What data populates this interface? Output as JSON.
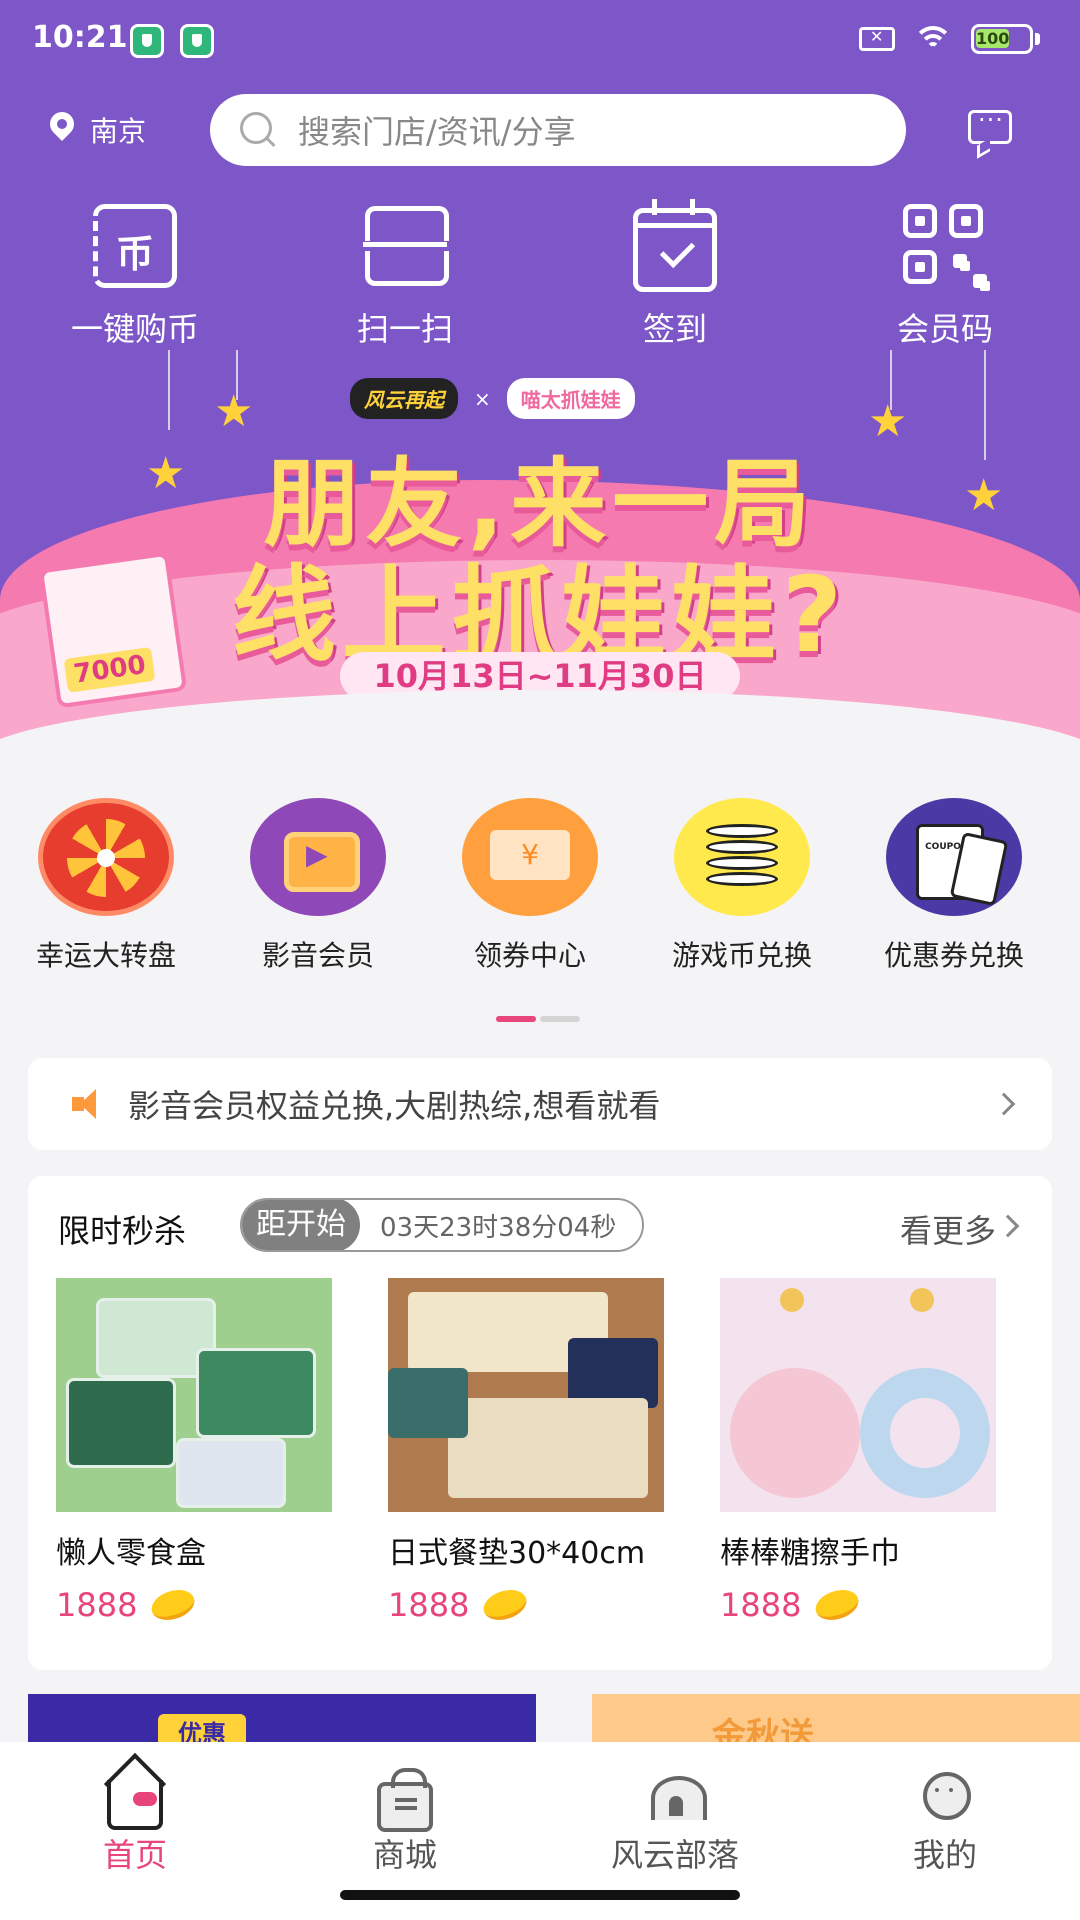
{
  "status_bar": {
    "time": "10:21",
    "battery": "100"
  },
  "header": {
    "city": "南京",
    "search_placeholder": "搜索门店/资讯/分享",
    "quick_actions": [
      {
        "label": "一键购币",
        "icon": "coin-icon",
        "glyph": "币"
      },
      {
        "label": "扫一扫",
        "icon": "scan-icon"
      },
      {
        "label": "签到",
        "icon": "calendar-check-icon"
      },
      {
        "label": "会员码",
        "icon": "qr-code-icon"
      }
    ]
  },
  "banner": {
    "brand_left": "风云再起",
    "separator": "×",
    "brand_right": "喵太抓娃娃",
    "headline_1": "朋友,来一局",
    "headline_2": "线上抓娃娃?",
    "dates": "10月13日~11月30日",
    "ticket_value": "7000"
  },
  "features": [
    {
      "label": "幸运大转盘",
      "icon": "lucky-wheel-icon"
    },
    {
      "label": "影音会员",
      "icon": "tv-play-icon"
    },
    {
      "label": "领券中心",
      "icon": "coupon-ticket-icon"
    },
    {
      "label": "游戏币兑换",
      "icon": "game-coins-icon"
    },
    {
      "label": "优惠券兑换",
      "icon": "voucher-icon"
    }
  ],
  "carousel": {
    "pages": 2,
    "active": 1
  },
  "notice": {
    "text": "影音会员权益兑换,大剧热综,想看就看"
  },
  "flash_sale": {
    "title": "限时秒杀",
    "countdown_label": "距开始",
    "countdown_value": "03天23时38分04秒",
    "more": "看更多",
    "products": [
      {
        "name": "懒人零食盒",
        "price": "1888"
      },
      {
        "name": "日式餐垫30*40cm",
        "price": "1888"
      },
      {
        "name": "棒棒糖擦手巾",
        "price": "1888"
      }
    ]
  },
  "peek_banners": {
    "left": "优惠",
    "right": "金秋送"
  },
  "bottom_nav": [
    {
      "label": "首页",
      "icon": "home-icon",
      "active": true
    },
    {
      "label": "商城",
      "icon": "shop-bag-icon",
      "active": false
    },
    {
      "label": "风云部落",
      "icon": "tribe-tent-icon",
      "active": false
    },
    {
      "label": "我的",
      "icon": "profile-icon",
      "active": false
    }
  ],
  "colors": {
    "primary": "#7d56c8",
    "accent": "#e8457a",
    "banner_pink": "#f47ab0",
    "headline_yellow": "#ffe066"
  }
}
